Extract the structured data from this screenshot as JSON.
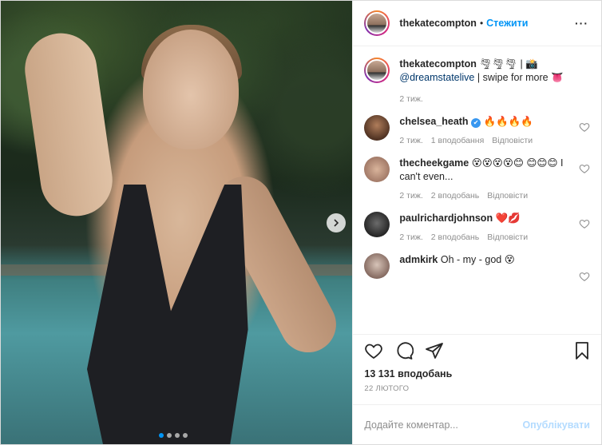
{
  "header": {
    "username": "thekatecompton",
    "bullet": "•",
    "follow_label": "Стежити",
    "more_label": "···"
  },
  "caption": {
    "username": "thekatecompton",
    "emoji": "🌪🌪🌪 | 📸",
    "mention": "@dreamstatelive",
    "text": " | swipe for more 👅",
    "age": "2 тиж."
  },
  "comments": [
    {
      "username": "chelsea_heath",
      "verified": "✔",
      "text": "🔥🔥🔥🔥",
      "age": "2 тиж.",
      "likes": "1 вподобання",
      "reply": "Відповісти"
    },
    {
      "username": "thecheekgame",
      "text": "😵😵😵😵😊 😊😊😊 I can't even...",
      "age": "2 тиж.",
      "likes": "2 вподобань",
      "reply": "Відповісти"
    },
    {
      "username": "paulrichardjohnson",
      "text": "❤️💋",
      "age": "2 тиж.",
      "likes": "2 вподобань",
      "reply": "Відповісти"
    },
    {
      "username": "admkirk",
      "text": "Oh - my - god 😵"
    }
  ],
  "likes_count": "13 131 вподобань",
  "post_date": "22 ЛЮТОГО",
  "add_comment": {
    "placeholder": "Додайте коментар...",
    "post_label": "Опублікувати"
  },
  "carousel": {
    "slides": 4,
    "active": 1
  },
  "colors": {
    "accent": "#0095f6",
    "text": "#262626",
    "muted": "#8e8e8e",
    "post_disabled": "#b3dbff"
  },
  "icons": [
    "chevron-right-icon",
    "heart-icon",
    "comment-icon",
    "share-icon",
    "bookmark-icon",
    "verified-badge-icon"
  ]
}
